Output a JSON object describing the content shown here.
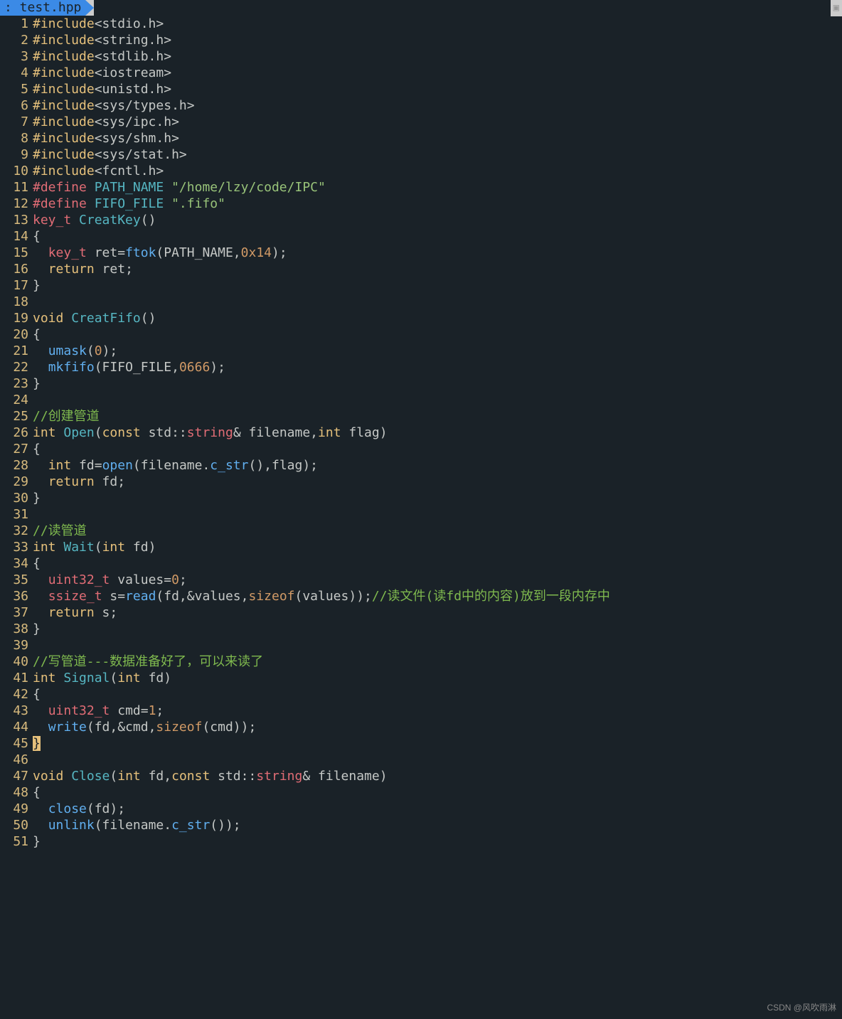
{
  "tab": {
    "filename": ": test.hpp"
  },
  "lines": [
    [
      {
        "t": "#include",
        "c": "kw-yellow"
      },
      {
        "t": "<stdio.h>",
        "c": "plain"
      }
    ],
    [
      {
        "t": "#include",
        "c": "kw-yellow"
      },
      {
        "t": "<string.h>",
        "c": "plain"
      }
    ],
    [
      {
        "t": "#include",
        "c": "kw-yellow"
      },
      {
        "t": "<stdlib.h>",
        "c": "plain"
      }
    ],
    [
      {
        "t": "#include",
        "c": "kw-yellow"
      },
      {
        "t": "<iostream>",
        "c": "plain"
      }
    ],
    [
      {
        "t": "#include",
        "c": "kw-yellow"
      },
      {
        "t": "<unistd.h>",
        "c": "plain"
      }
    ],
    [
      {
        "t": "#include",
        "c": "kw-yellow"
      },
      {
        "t": "<sys/types.h>",
        "c": "plain"
      }
    ],
    [
      {
        "t": "#include",
        "c": "kw-yellow"
      },
      {
        "t": "<sys/ipc.h>",
        "c": "plain"
      }
    ],
    [
      {
        "t": "#include",
        "c": "kw-yellow"
      },
      {
        "t": "<sys/shm.h>",
        "c": "plain"
      }
    ],
    [
      {
        "t": "#include",
        "c": "kw-yellow"
      },
      {
        "t": "<sys/stat.h>",
        "c": "plain"
      }
    ],
    [
      {
        "t": "#include",
        "c": "kw-yellow"
      },
      {
        "t": "<fcntl.h>",
        "c": "plain"
      }
    ],
    [
      {
        "t": "#define",
        "c": "kw-red"
      },
      {
        "t": " ",
        "c": "plain"
      },
      {
        "t": "PATH_NAME",
        "c": "fn-blue"
      },
      {
        "t": " ",
        "c": "plain"
      },
      {
        "t": "\"/home/lzy/code/IPC\"",
        "c": "str"
      }
    ],
    [
      {
        "t": "#define",
        "c": "kw-red"
      },
      {
        "t": " ",
        "c": "plain"
      },
      {
        "t": "FIFO_FILE",
        "c": "fn-blue"
      },
      {
        "t": " ",
        "c": "plain"
      },
      {
        "t": "\".fifo\"",
        "c": "str"
      }
    ],
    [
      {
        "t": "key_t",
        "c": "kw-red"
      },
      {
        "t": " ",
        "c": "plain"
      },
      {
        "t": "CreatKey",
        "c": "fn-blue"
      },
      {
        "t": "()",
        "c": "plain"
      }
    ],
    [
      {
        "t": "{",
        "c": "plain"
      }
    ],
    [
      {
        "t": "  ",
        "c": "plain"
      },
      {
        "t": "key_t",
        "c": "kw-red"
      },
      {
        "t": " ret=",
        "c": "plain"
      },
      {
        "t": "ftok",
        "c": "fn-call"
      },
      {
        "t": "(PATH_NAME,",
        "c": "plain"
      },
      {
        "t": "0x14",
        "c": "num"
      },
      {
        "t": ");",
        "c": "plain"
      }
    ],
    [
      {
        "t": "  ",
        "c": "plain"
      },
      {
        "t": "return",
        "c": "kw-yellow"
      },
      {
        "t": " ret;",
        "c": "plain"
      }
    ],
    [
      {
        "t": "}",
        "c": "plain"
      }
    ],
    [],
    [
      {
        "t": "void",
        "c": "kw-yellow"
      },
      {
        "t": " ",
        "c": "plain"
      },
      {
        "t": "CreatFifo",
        "c": "fn-blue"
      },
      {
        "t": "()",
        "c": "plain"
      }
    ],
    [
      {
        "t": "{",
        "c": "plain"
      }
    ],
    [
      {
        "t": "  ",
        "c": "plain"
      },
      {
        "t": "umask",
        "c": "fn-call"
      },
      {
        "t": "(",
        "c": "plain"
      },
      {
        "t": "0",
        "c": "num"
      },
      {
        "t": ");",
        "c": "plain"
      }
    ],
    [
      {
        "t": "  ",
        "c": "plain"
      },
      {
        "t": "mkfifo",
        "c": "fn-call"
      },
      {
        "t": "(FIFO_FILE,",
        "c": "plain"
      },
      {
        "t": "0666",
        "c": "num"
      },
      {
        "t": ");",
        "c": "plain"
      }
    ],
    [
      {
        "t": "}",
        "c": "plain"
      }
    ],
    [],
    [
      {
        "t": "//创建管道",
        "c": "cmt"
      }
    ],
    [
      {
        "t": "int",
        "c": "kw-yellow"
      },
      {
        "t": " ",
        "c": "plain"
      },
      {
        "t": "Open",
        "c": "fn-blue"
      },
      {
        "t": "(",
        "c": "plain"
      },
      {
        "t": "const",
        "c": "kw-yellow"
      },
      {
        "t": " std::",
        "c": "plain"
      },
      {
        "t": "string",
        "c": "kw-red"
      },
      {
        "t": "& filename,",
        "c": "plain"
      },
      {
        "t": "int",
        "c": "kw-yellow"
      },
      {
        "t": " flag)",
        "c": "plain"
      }
    ],
    [
      {
        "t": "{",
        "c": "plain"
      }
    ],
    [
      {
        "t": "  ",
        "c": "plain"
      },
      {
        "t": "int",
        "c": "kw-yellow"
      },
      {
        "t": " fd=",
        "c": "plain"
      },
      {
        "t": "open",
        "c": "fn-call"
      },
      {
        "t": "(filename.",
        "c": "plain"
      },
      {
        "t": "c_str",
        "c": "fn-call"
      },
      {
        "t": "(),flag);",
        "c": "plain"
      }
    ],
    [
      {
        "t": "  ",
        "c": "plain"
      },
      {
        "t": "return",
        "c": "kw-yellow"
      },
      {
        "t": " fd;",
        "c": "plain"
      }
    ],
    [
      {
        "t": "}",
        "c": "plain"
      }
    ],
    [],
    [
      {
        "t": "//读管道",
        "c": "cmt"
      }
    ],
    [
      {
        "t": "int",
        "c": "kw-yellow"
      },
      {
        "t": " ",
        "c": "plain"
      },
      {
        "t": "Wait",
        "c": "fn-blue"
      },
      {
        "t": "(",
        "c": "plain"
      },
      {
        "t": "int",
        "c": "kw-yellow"
      },
      {
        "t": " fd)",
        "c": "plain"
      }
    ],
    [
      {
        "t": "{",
        "c": "plain"
      }
    ],
    [
      {
        "t": "  ",
        "c": "plain"
      },
      {
        "t": "uint32_t",
        "c": "kw-red"
      },
      {
        "t": " values=",
        "c": "plain"
      },
      {
        "t": "0",
        "c": "num"
      },
      {
        "t": ";",
        "c": "plain"
      }
    ],
    [
      {
        "t": "  ",
        "c": "plain"
      },
      {
        "t": "ssize_t",
        "c": "kw-red"
      },
      {
        "t": " s=",
        "c": "plain"
      },
      {
        "t": "read",
        "c": "fn-call"
      },
      {
        "t": "(fd,&values,",
        "c": "plain"
      },
      {
        "t": "sizeof",
        "c": "op-orange"
      },
      {
        "t": "(values));",
        "c": "plain"
      },
      {
        "t": "//读文件(读fd中的内容)放到一段内存中",
        "c": "cmt"
      }
    ],
    [
      {
        "t": "  ",
        "c": "plain"
      },
      {
        "t": "return",
        "c": "kw-yellow"
      },
      {
        "t": " s;",
        "c": "plain"
      }
    ],
    [
      {
        "t": "}",
        "c": "plain"
      }
    ],
    [],
    [
      {
        "t": "//写管道---数据准备好了，可以来读了",
        "c": "cmt"
      }
    ],
    [
      {
        "t": "int",
        "c": "kw-yellow"
      },
      {
        "t": " ",
        "c": "plain"
      },
      {
        "t": "Signal",
        "c": "fn-blue"
      },
      {
        "t": "(",
        "c": "plain"
      },
      {
        "t": "int",
        "c": "kw-yellow"
      },
      {
        "t": " fd)",
        "c": "plain"
      }
    ],
    [
      {
        "t": "{",
        "c": "plain"
      }
    ],
    [
      {
        "t": "  ",
        "c": "plain"
      },
      {
        "t": "uint32_t",
        "c": "kw-red"
      },
      {
        "t": " cmd=",
        "c": "plain"
      },
      {
        "t": "1",
        "c": "num"
      },
      {
        "t": ";",
        "c": "plain"
      }
    ],
    [
      {
        "t": "  ",
        "c": "plain"
      },
      {
        "t": "write",
        "c": "fn-call"
      },
      {
        "t": "(fd,&cmd,",
        "c": "plain"
      },
      {
        "t": "sizeof",
        "c": "op-orange"
      },
      {
        "t": "(cmd));",
        "c": "plain"
      }
    ],
    [
      {
        "t": "}",
        "c": "hl-cursor"
      }
    ],
    [],
    [
      {
        "t": "void",
        "c": "kw-yellow"
      },
      {
        "t": " ",
        "c": "plain"
      },
      {
        "t": "Close",
        "c": "fn-blue"
      },
      {
        "t": "(",
        "c": "plain"
      },
      {
        "t": "int",
        "c": "kw-yellow"
      },
      {
        "t": " fd,",
        "c": "plain"
      },
      {
        "t": "const",
        "c": "kw-yellow"
      },
      {
        "t": " std::",
        "c": "plain"
      },
      {
        "t": "string",
        "c": "kw-red"
      },
      {
        "t": "& filename)",
        "c": "plain"
      }
    ],
    [
      {
        "t": "{",
        "c": "plain"
      }
    ],
    [
      {
        "t": "  ",
        "c": "plain"
      },
      {
        "t": "close",
        "c": "fn-call"
      },
      {
        "t": "(fd);",
        "c": "plain"
      }
    ],
    [
      {
        "t": "  ",
        "c": "plain"
      },
      {
        "t": "unlink",
        "c": "fn-call"
      },
      {
        "t": "(filename.",
        "c": "plain"
      },
      {
        "t": "c_str",
        "c": "fn-call"
      },
      {
        "t": "());",
        "c": "plain"
      }
    ],
    [
      {
        "t": "}",
        "c": "plain"
      }
    ]
  ],
  "watermark": "CSDN @风吹雨淋"
}
